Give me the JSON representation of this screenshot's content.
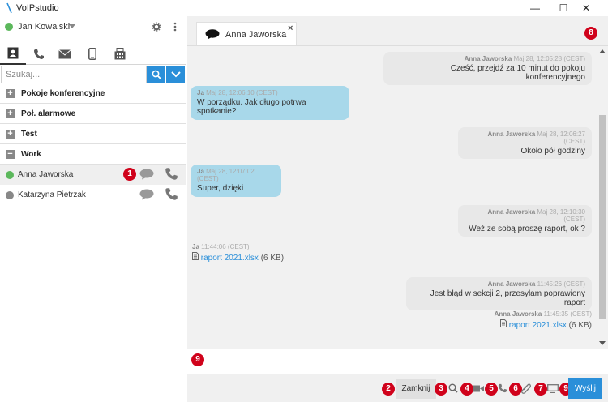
{
  "window": {
    "title": "VoIPstudio",
    "minimize": "—",
    "maximize": "☐",
    "close": "✕"
  },
  "user": {
    "name": "Jan Kowalski",
    "status_color": "#5cb85c"
  },
  "search": {
    "placeholder": "Szukaj..."
  },
  "groups": [
    {
      "label": "Pokoje konferencyjne",
      "symbol": "+"
    },
    {
      "label": "Poł. alarmowe",
      "symbol": "+"
    },
    {
      "label": "Test",
      "symbol": "+"
    },
    {
      "label": "Work",
      "symbol": "−"
    }
  ],
  "contacts": [
    {
      "name": "Anna Jaworska",
      "status_color": "#5cb85c"
    },
    {
      "name": "Katarzyna Pietrzak",
      "status_color": "#888888"
    }
  ],
  "chat": {
    "tab_label": "Anna Jaworska",
    "tab_close": "×",
    "messages": [
      {
        "sender": "Anna Jaworska",
        "time": "Maj 28, 12:05:28 (CEST)",
        "text": "Cześć, przejdź za 10 minut do pokoju konferencyjnego"
      },
      {
        "sender": "Ja",
        "time": "Maj 28, 12:06:10 (CEST)",
        "text": "W porządku. Jak długo potrwa spotkanie?"
      },
      {
        "sender": "Anna Jaworska",
        "time": "Maj 28, 12:06:27 (CEST)",
        "text": "Około pół godziny"
      },
      {
        "sender": "Ja",
        "time": "Maj 28, 12:07:02 (CEST)",
        "text": "Super, dzięki"
      },
      {
        "sender": "Anna Jaworska",
        "time": "Maj 28, 12:10:30 (CEST)",
        "text": "Weź ze sobą proszę raport, ok ?"
      },
      {
        "sender": "Ja",
        "time": "11:44:06 (CEST)",
        "file": "raport 2021.xlsx",
        "size": "(6 KB)"
      },
      {
        "sender": "Anna Jaworska",
        "time": "11:45:26 (CEST)",
        "text": "Jest błąd w sekcji 2, przesyłam poprawiony raport"
      },
      {
        "sender": "Anna Jaworska",
        "time": "11:45:35 (CEST)",
        "file": "raport 2021.xlsx",
        "size": "(6 KB)"
      }
    ]
  },
  "buttons": {
    "close": "Zamknij",
    "send": "Wyślij"
  },
  "badges": [
    "1",
    "2",
    "3",
    "4",
    "5",
    "6",
    "7",
    "8",
    "9",
    "9"
  ],
  "colors": {
    "accent": "#2a8fd9",
    "badge": "#d0021b",
    "outgoing_bubble": "#a8d8ea"
  }
}
